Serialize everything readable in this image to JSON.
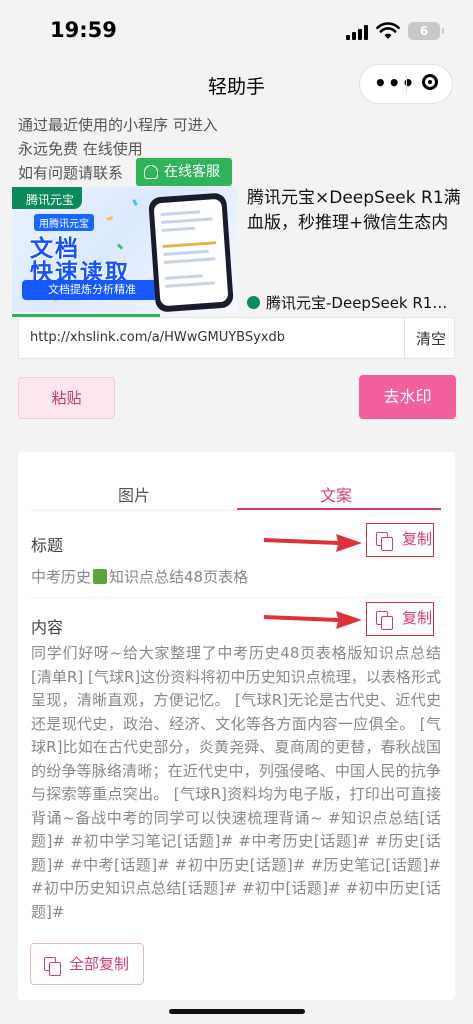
{
  "status_bar": {
    "time": "19:59",
    "battery": "6"
  },
  "nav": {
    "title": "轻助手",
    "more_icon": "more-dots-icon",
    "close_icon": "target-icon"
  },
  "notice": {
    "line1": "通过最近使用的小程序 可进入",
    "line2": "永远免费 在线使用",
    "line3": "如有问题请联系",
    "service_button": "在线客服"
  },
  "ad": {
    "image_brand": "腾讯元宝",
    "image_tag": "用腾讯元宝",
    "image_line1": "文档",
    "image_line2": "快速读取",
    "image_sub": "文档提炼分析精准",
    "title": "腾讯元宝×DeepSeek R1满血版，秒推理+微信生态内",
    "footer": "腾讯元宝-DeepSeek R1联…"
  },
  "url_input": {
    "value": "http://xhslink.com/a/HWwGMUYBSyxdb",
    "clear_label": "清空"
  },
  "actions": {
    "paste_label": "粘贴",
    "watermark_label": "去水印"
  },
  "tabs": [
    {
      "label": "图片"
    },
    {
      "label": "文案",
      "active": true
    }
  ],
  "title_section": {
    "label": "标题",
    "copy_label": "复制",
    "value_before": "中考历史",
    "value_after": "知识点总结48页表格"
  },
  "content_section": {
    "label": "内容",
    "copy_label": "复制",
    "text": "同学们好呀~给大家整理了中考历史48页表格版知识点总结[清单R] [气球R]这份资料将初中历史知识点梳理，以表格形式呈现，清晰直观，方便记忆。 [气球R]无论是古代史、近代史还是现代史，政治、经济、文化等各方面内容一应俱全。 [气球R]比如在古代史部分，炎黄尧舜、夏商周的更替，春秋战国的纷争等脉络清晰；在近代史中，列强侵略、中国人民的抗争与探索等重点突出。 [气球R]资料均为电子版，打印出可直接背诵~备战中考的同学可以快速梳理背诵~ #知识点总结[话题]# #初中学习笔记[话题]# #中考历史[话题]# #历史[话题]# #中考[话题]# #初中历史[话题]# #历史笔记[话题]# #初中历史知识点总结[话题]# #初中[话题]# #初中历史[话题]#"
  },
  "copy_all_label": "全部复制",
  "colors": {
    "accent": "#d03c7a",
    "primary_button": "#f260a0",
    "service_green": "#2fb45a",
    "arrow_red": "#e0303a"
  }
}
